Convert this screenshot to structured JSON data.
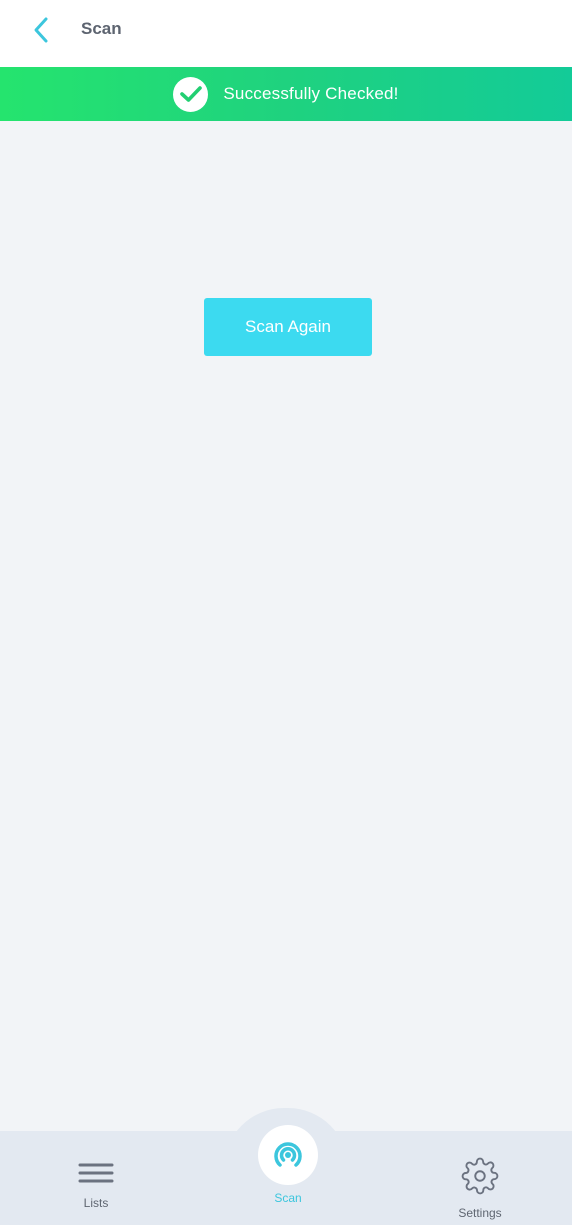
{
  "header": {
    "title": "Scan",
    "back_icon": "chevron-left-icon"
  },
  "banner": {
    "icon": "check-circle-icon",
    "text": "Successfully Checked!"
  },
  "main": {
    "scan_again_label": "Scan Again"
  },
  "bottom_nav": {
    "items": [
      {
        "label": "Lists",
        "icon": "menu-lines-icon",
        "active": false
      },
      {
        "label": "Scan",
        "icon": "broadcast-icon",
        "active": true
      },
      {
        "label": "Settings",
        "icon": "gear-icon",
        "active": false
      }
    ]
  },
  "colors": {
    "accent": "#3cdaf0",
    "banner_start": "#25e46e",
    "banner_end": "#13cb98",
    "background": "#f2f4f7",
    "nav_background": "#e3e9f1"
  }
}
